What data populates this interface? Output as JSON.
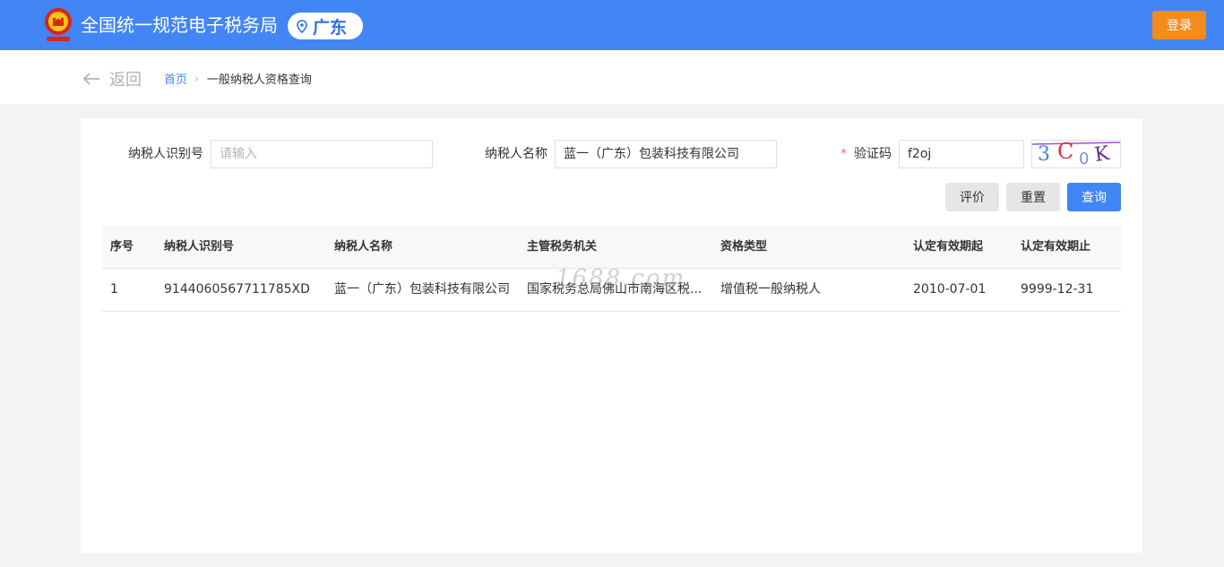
{
  "header": {
    "app_title": "全国统一规范电子税务局",
    "region": "广东",
    "login_label": "登录",
    "brand_color": "#4285f4",
    "login_color": "#f48b1d"
  },
  "nav": {
    "back_label": "返回",
    "breadcrumb_home": "首页",
    "breadcrumb_current": "一般纳税人资格查询"
  },
  "form": {
    "taxpayer_id_label": "纳税人识别号",
    "taxpayer_id_value": "",
    "taxpayer_id_placeholder": "请输入",
    "taxpayer_name_label": "纳税人名称",
    "taxpayer_name_value": "蓝一（广东）包装科技有限公司",
    "captcha_required_mark": "*",
    "captcha_label": "验证码",
    "captcha_value": "f2oj",
    "captcha_image_text": "3C0K"
  },
  "buttons": {
    "evaluate": "评价",
    "reset": "重置",
    "query": "查询"
  },
  "table": {
    "columns": [
      "序号",
      "纳税人识别号",
      "纳税人名称",
      "主管税务机关",
      "资格类型",
      "认定有效期起",
      "认定有效期止"
    ],
    "rows": [
      [
        "1",
        "9144060567711785XD",
        "蓝一（广东）包装科技有限公司",
        "国家税务总局佛山市南海区税...",
        "增值税一般纳税人",
        "2010-07-01",
        "9999-12-31"
      ]
    ]
  },
  "watermark": "1688.com"
}
